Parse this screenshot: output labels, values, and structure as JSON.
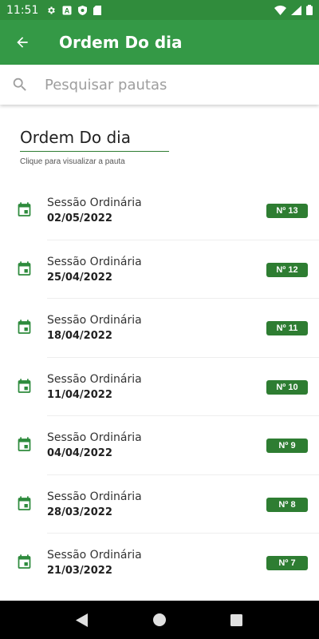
{
  "status_bar": {
    "time": "11:51"
  },
  "app_bar": {
    "title": "Ordem Do dia"
  },
  "search": {
    "placeholder": "Pesquisar pautas"
  },
  "section": {
    "heading": "Ordem Do dia",
    "subheading": "Clique para visualizar a pauta"
  },
  "sessions": [
    {
      "label": "Sessão Ordinária",
      "date": "02/05/2022",
      "badge": "Nº 13"
    },
    {
      "label": "Sessão Ordinária",
      "date": "25/04/2022",
      "badge": "Nº 12"
    },
    {
      "label": "Sessão Ordinária",
      "date": "18/04/2022",
      "badge": "Nº 11"
    },
    {
      "label": "Sessão Ordinária",
      "date": "11/04/2022",
      "badge": "Nº 10"
    },
    {
      "label": "Sessão Ordinária",
      "date": "04/04/2022",
      "badge": "Nº 9"
    },
    {
      "label": "Sessão Ordinária",
      "date": "28/03/2022",
      "badge": "Nº 8"
    },
    {
      "label": "Sessão Ordinária",
      "date": "21/03/2022",
      "badge": "Nº 7"
    }
  ],
  "colors": {
    "primary": "#349946",
    "status": "#308c3c",
    "accent": "#2e7d32"
  },
  "icons": {
    "back": "arrow-back-icon",
    "search": "search-icon",
    "item": "calendar-event-icon"
  }
}
